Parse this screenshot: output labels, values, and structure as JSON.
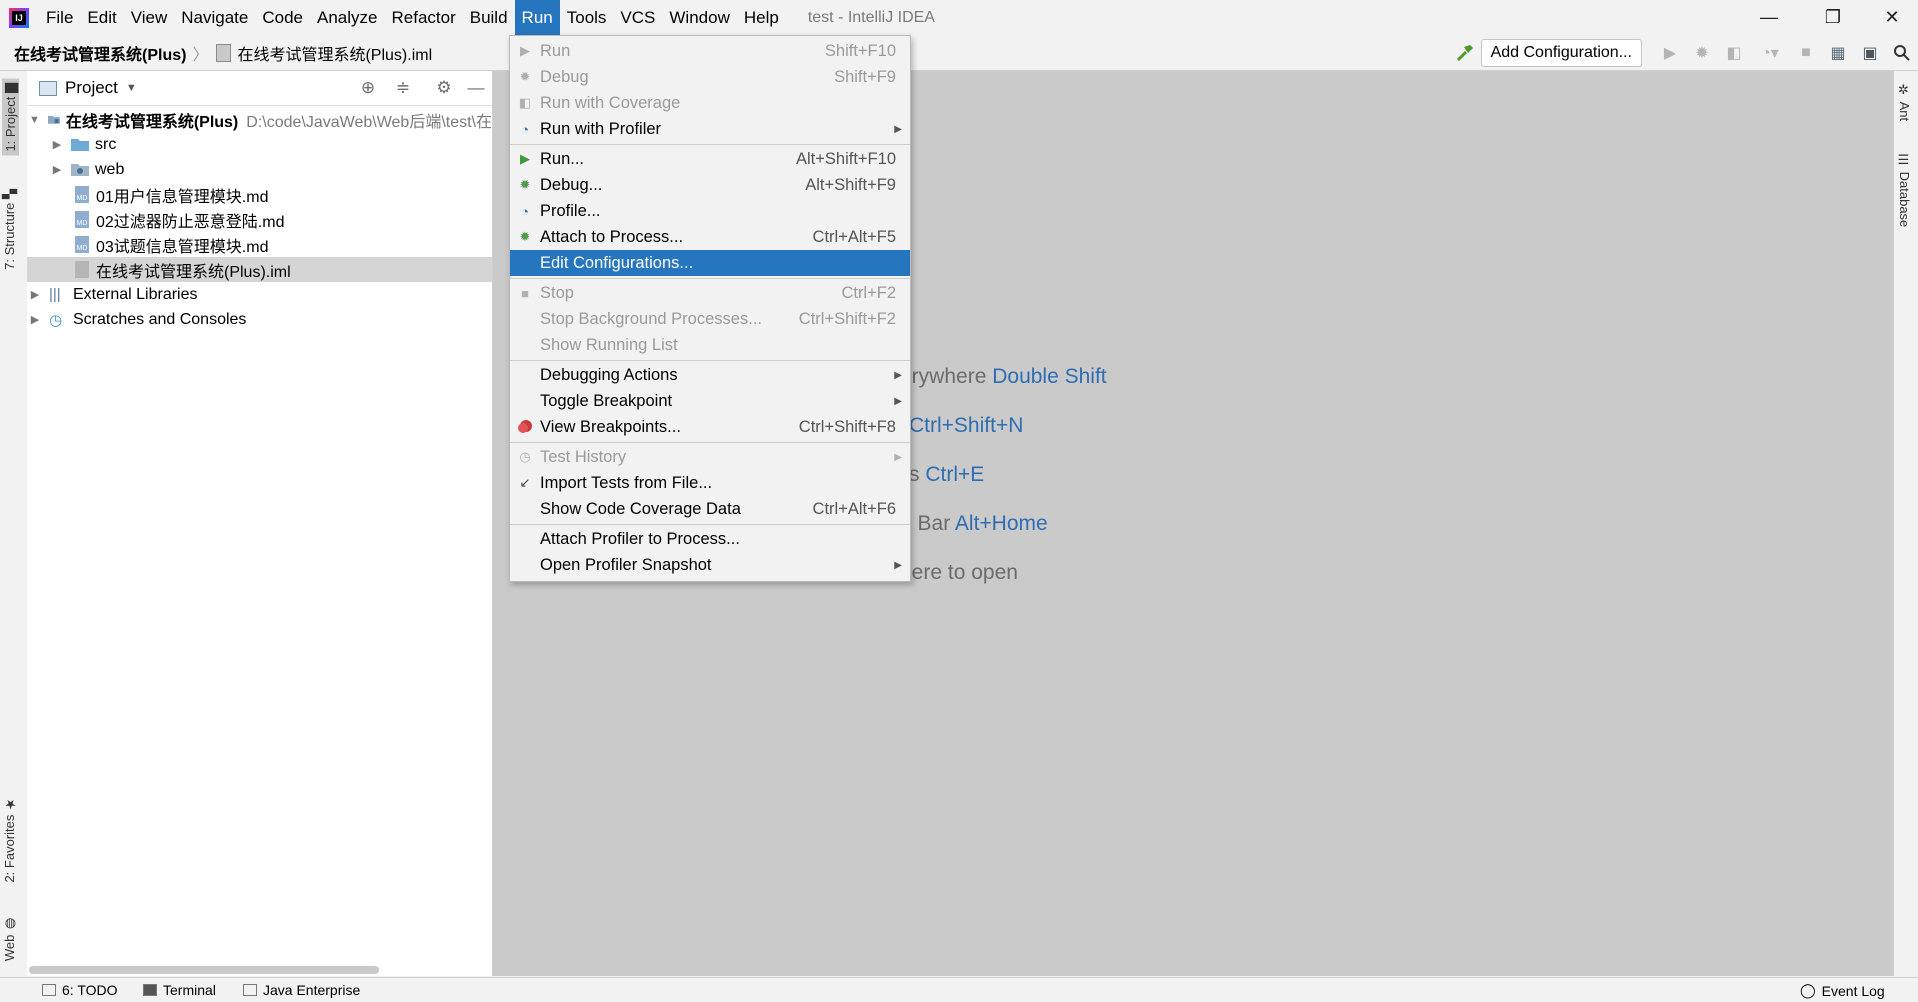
{
  "window": {
    "title": "test - IntelliJ IDEA",
    "minimize": "—",
    "restore": "❐",
    "close": "✕"
  },
  "menubar": [
    "File",
    "Edit",
    "View",
    "Navigate",
    "Code",
    "Analyze",
    "Refactor",
    "Build",
    "Run",
    "Tools",
    "VCS",
    "Window",
    "Help"
  ],
  "active_menu": "Run",
  "breadcrumb": {
    "project": "在线考试管理系统(Plus)",
    "file": "在线考试管理系统(Plus).iml"
  },
  "toolbar": {
    "add_configuration": "Add Configuration..."
  },
  "left_tabs": {
    "project": "1: Project",
    "structure": "7: Structure",
    "favorites": "2: Favorites",
    "web": "Web"
  },
  "right_tabs": {
    "ant": "Ant",
    "database": "Database"
  },
  "project_panel": {
    "title": "Project",
    "root": {
      "name": "在线考试管理系统(Plus)",
      "path": "D:\\code\\JavaWeb\\Web后端\\test\\在"
    },
    "items": [
      {
        "name": "src",
        "kind": "folder"
      },
      {
        "name": "web",
        "kind": "folder"
      },
      {
        "name": "01用户信息管理模块.md",
        "kind": "md"
      },
      {
        "name": "02过滤器防止恶意登陆.md",
        "kind": "md"
      },
      {
        "name": "03试题信息管理模块.md",
        "kind": "md"
      },
      {
        "name": "在线考试管理系统(Plus).iml",
        "kind": "iml"
      }
    ],
    "external_libraries": "External Libraries",
    "scratches": "Scratches and Consoles"
  },
  "editor_hints": [
    {
      "text": "erywhere",
      "key": "Double Shift"
    },
    {
      "text": "",
      "key": "Ctrl+Shift+N"
    },
    {
      "text": "s",
      "key": "Ctrl+E"
    },
    {
      "text": "n Bar",
      "key": "Alt+Home"
    },
    {
      "text": "here to open",
      "key": ""
    }
  ],
  "run_menu": {
    "items": [
      {
        "label": "Run",
        "shortcut": "Shift+F10",
        "icon": "run-icon",
        "disabled": true
      },
      {
        "label": "Debug",
        "shortcut": "Shift+F9",
        "icon": "debug-icon",
        "disabled": true
      },
      {
        "label": "Run with Coverage",
        "shortcut": "",
        "icon": "coverage-icon",
        "disabled": true
      },
      {
        "label": "Run with Profiler",
        "shortcut": "",
        "icon": "profiler-icon",
        "submenu": true
      },
      {
        "label": "Run...",
        "shortcut": "Alt+Shift+F10",
        "icon": "run-icon"
      },
      {
        "label": "Debug...",
        "shortcut": "Alt+Shift+F9",
        "icon": "debug-icon"
      },
      {
        "label": "Profile...",
        "shortcut": "",
        "icon": "profile-icon"
      },
      {
        "label": "Attach to Process...",
        "shortcut": "Ctrl+Alt+F5",
        "icon": "attach-icon"
      },
      {
        "label": "Edit Configurations...",
        "shortcut": "",
        "highlighted": true
      },
      {
        "label": "Stop",
        "shortcut": "Ctrl+F2",
        "icon": "stop-icon",
        "disabled": true
      },
      {
        "label": "Stop Background Processes...",
        "shortcut": "Ctrl+Shift+F2",
        "disabled": true
      },
      {
        "label": "Show Running List",
        "shortcut": "",
        "disabled": true
      },
      {
        "label": "Debugging Actions",
        "shortcut": "",
        "submenu": true
      },
      {
        "label": "Toggle Breakpoint",
        "shortcut": "",
        "submenu": true
      },
      {
        "label": "View Breakpoints...",
        "shortcut": "Ctrl+Shift+F8",
        "icon": "breakpoints-icon"
      },
      {
        "label": "Test History",
        "shortcut": "",
        "icon": "history-icon",
        "disabled": true,
        "submenu": true
      },
      {
        "label": "Import Tests from File...",
        "shortcut": "",
        "icon": "import-icon"
      },
      {
        "label": "Show Code Coverage Data",
        "shortcut": "Ctrl+Alt+F6"
      },
      {
        "label": "Attach Profiler to Process...",
        "shortcut": ""
      },
      {
        "label": "Open Profiler Snapshot",
        "shortcut": "",
        "submenu": true
      }
    ]
  },
  "bottom_bar": {
    "todo": "6: TODO",
    "terminal": "Terminal",
    "java_enterprise": "Java Enterprise",
    "event_log": "Event Log"
  },
  "colors": {
    "accent": "#2675bf",
    "editor_bg": "#cacaca",
    "shortcut_link": "#2f6db3"
  }
}
